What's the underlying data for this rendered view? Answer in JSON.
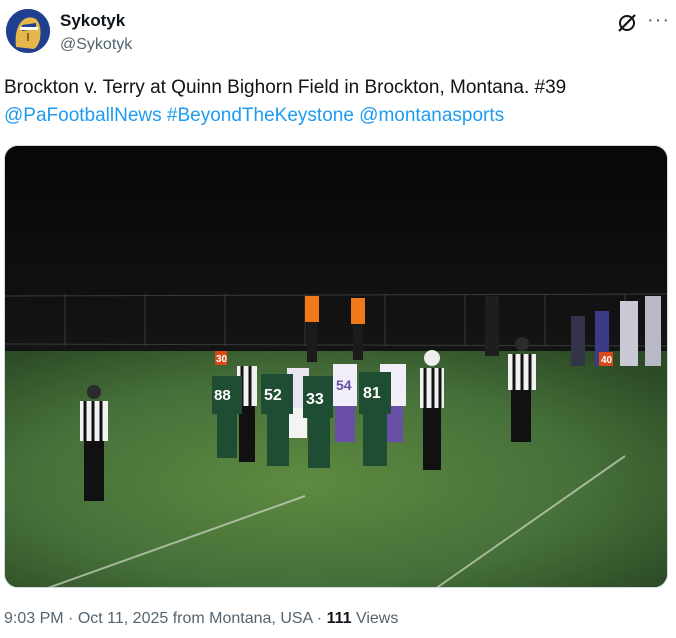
{
  "author": {
    "name": "Sykotyk",
    "handle": "@Sykotyk"
  },
  "icons": {
    "grok": "grok-icon",
    "more": "more-icon"
  },
  "tweet": {
    "text": "Brockton v. Terry at Quinn Bighorn Field in Brockton, Montana. #39",
    "tags": [
      "@PaFootballNews",
      "#BeyondTheKeystone",
      "@montanasports"
    ]
  },
  "media": {
    "jersey_numbers": [
      "30",
      "88",
      "52",
      "33",
      "81",
      "54",
      "40"
    ]
  },
  "meta": {
    "time": "9:03 PM",
    "date": "Oct 11, 2025",
    "location": "from Montana, USA",
    "views_count": "111",
    "views_label": "Views"
  },
  "colors": {
    "link": "#1d9bf0",
    "secondary_text": "#536471",
    "jersey_green": "#1f4d33",
    "field_green": "#4f7a38"
  }
}
